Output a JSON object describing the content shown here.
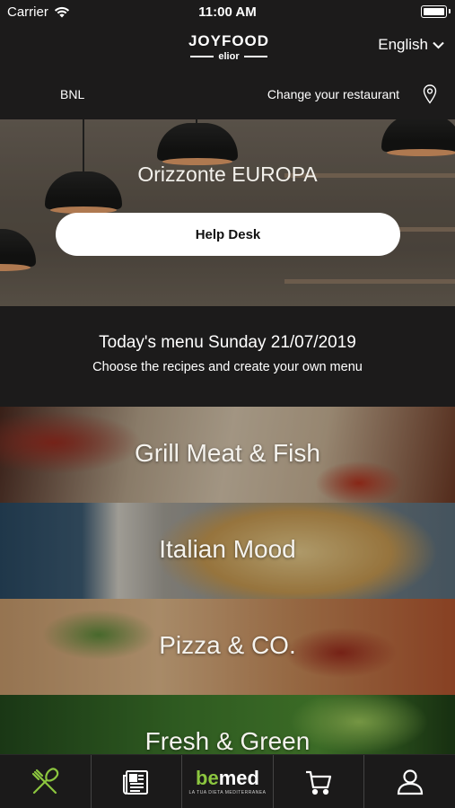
{
  "status": {
    "carrier": "Carrier",
    "time": "11:00 AM"
  },
  "header": {
    "logo_top": "JOYFOOD",
    "logo_sub": "elior",
    "language": "English"
  },
  "restaurant_bar": {
    "code": "BNL",
    "change_label": "Change your restaurant"
  },
  "hero": {
    "restaurant_name": "Orizzonte EUROPA",
    "help_desk_label": "Help Desk"
  },
  "today": {
    "heading": "Today's menu Sunday 21/07/2019",
    "subheading": "Choose the recipes and create your own menu"
  },
  "categories": [
    {
      "label": "Grill Meat & Fish"
    },
    {
      "label": "Italian Mood"
    },
    {
      "label": "Pizza & CO."
    },
    {
      "label": "Fresh & Green"
    }
  ],
  "tabbar": {
    "bemed_brand_a": "be",
    "bemed_brand_b": "med",
    "bemed_tag": "LA TUA DIETA MEDITERRANEA",
    "active_color": "#8cc63f"
  }
}
